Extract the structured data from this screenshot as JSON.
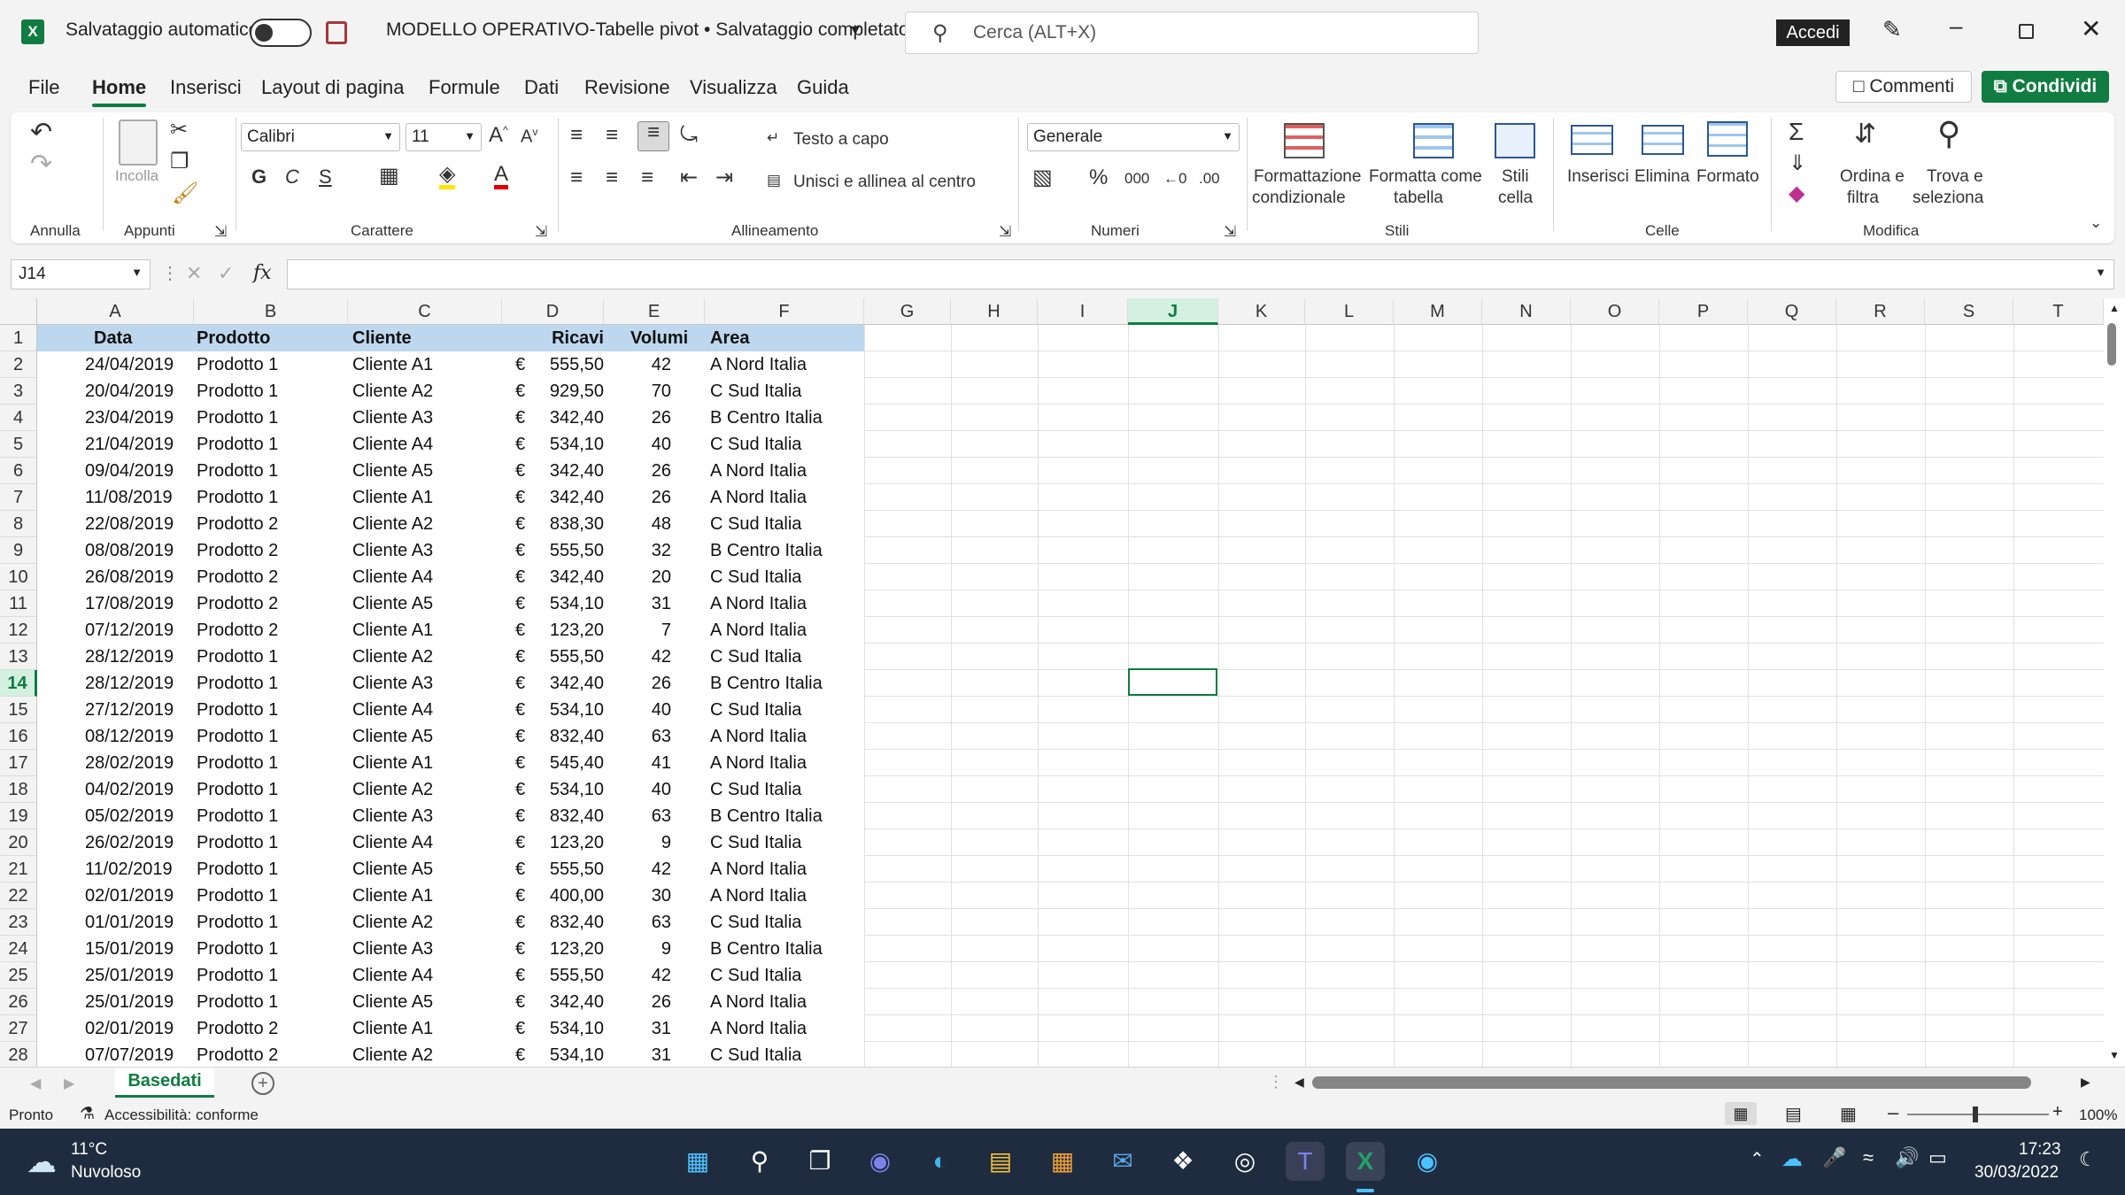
{
  "titlebar": {
    "autosave_label": "Salvataggio automatico",
    "autosave_state": "off",
    "doc_title": "MODELLO OPERATIVO-Tabelle pivot • Salvataggio completato",
    "search_placeholder": "Cerca (ALT+X)",
    "signin": "Accedi"
  },
  "menu": {
    "tabs": [
      "File",
      "Home",
      "Inserisci",
      "Layout di pagina",
      "Formule",
      "Dati",
      "Revisione",
      "Visualizza",
      "Guida"
    ],
    "active": "Home",
    "comments": "Commenti",
    "share": "Condividi"
  },
  "ribbon": {
    "groups": {
      "annulla": "Annulla",
      "appunti": "Appunti",
      "carattere": "Carattere",
      "allineamento": "Allineamento",
      "numeri": "Numeri",
      "stili": "Stili",
      "celle": "Celle",
      "modifica": "Modifica"
    },
    "paste": "Incolla",
    "font_name": "Calibri",
    "font_size": "11",
    "wrap_text": "Testo a capo",
    "merge_center": "Unisci e allinea al centro",
    "number_format": "Generale",
    "cond_format": [
      "Formattazione",
      "condizionale"
    ],
    "format_table": [
      "Formatta come",
      "tabella"
    ],
    "cell_styles": [
      "Stili",
      "cella"
    ],
    "insert": "Inserisci",
    "delete": "Elimina",
    "format": "Formato",
    "sort_filter": [
      "Ordina e",
      "filtra"
    ],
    "find_select": [
      "Trova e",
      "seleziona"
    ]
  },
  "formula_bar": {
    "name_box": "J14",
    "fx": "fx",
    "content": ""
  },
  "colors": {
    "accent": "#107c41",
    "header_fill": "#bdd7ee",
    "taskbar": "#1f2c3f"
  },
  "columns": [
    "A",
    "B",
    "C",
    "D",
    "E",
    "F",
    "G",
    "H",
    "I",
    "J",
    "K",
    "L",
    "M",
    "N",
    "O",
    "P",
    "Q",
    "R",
    "S",
    "T"
  ],
  "table": {
    "headers": [
      "Data",
      "Prodotto",
      "Cliente",
      "Ricavi",
      "Volumi",
      "Area"
    ],
    "currency": "€",
    "rows": [
      [
        "24/04/2019",
        "Prodotto 1",
        "Cliente A1",
        "555,50",
        "42",
        "A Nord Italia"
      ],
      [
        "20/04/2019",
        "Prodotto 1",
        "Cliente A2",
        "929,50",
        "70",
        "C Sud Italia"
      ],
      [
        "23/04/2019",
        "Prodotto 1",
        "Cliente A3",
        "342,40",
        "26",
        "B Centro Italia"
      ],
      [
        "21/04/2019",
        "Prodotto 1",
        "Cliente A4",
        "534,10",
        "40",
        "C Sud Italia"
      ],
      [
        "09/04/2019",
        "Prodotto 1",
        "Cliente A5",
        "342,40",
        "26",
        "A Nord Italia"
      ],
      [
        "11/08/2019",
        "Prodotto 1",
        "Cliente A1",
        "342,40",
        "26",
        "A Nord Italia"
      ],
      [
        "22/08/2019",
        "Prodotto 2",
        "Cliente A2",
        "838,30",
        "48",
        "C Sud Italia"
      ],
      [
        "08/08/2019",
        "Prodotto 2",
        "Cliente A3",
        "555,50",
        "32",
        "B Centro Italia"
      ],
      [
        "26/08/2019",
        "Prodotto 2",
        "Cliente A4",
        "342,40",
        "20",
        "C Sud Italia"
      ],
      [
        "17/08/2019",
        "Prodotto 2",
        "Cliente A5",
        "534,10",
        "31",
        "A Nord Italia"
      ],
      [
        "07/12/2019",
        "Prodotto 2",
        "Cliente A1",
        "123,20",
        "7",
        "A Nord Italia"
      ],
      [
        "28/12/2019",
        "Prodotto 1",
        "Cliente A2",
        "555,50",
        "42",
        "C Sud Italia"
      ],
      [
        "28/12/2019",
        "Prodotto 1",
        "Cliente A3",
        "342,40",
        "26",
        "B Centro Italia"
      ],
      [
        "27/12/2019",
        "Prodotto 1",
        "Cliente A4",
        "534,10",
        "40",
        "C Sud Italia"
      ],
      [
        "08/12/2019",
        "Prodotto 1",
        "Cliente A5",
        "832,40",
        "63",
        "A Nord Italia"
      ],
      [
        "28/02/2019",
        "Prodotto 1",
        "Cliente A1",
        "545,40",
        "41",
        "A Nord Italia"
      ],
      [
        "04/02/2019",
        "Prodotto 1",
        "Cliente A2",
        "534,10",
        "40",
        "C Sud Italia"
      ],
      [
        "05/02/2019",
        "Prodotto 1",
        "Cliente A3",
        "832,40",
        "63",
        "B Centro Italia"
      ],
      [
        "26/02/2019",
        "Prodotto 1",
        "Cliente A4",
        "123,20",
        "9",
        "C Sud Italia"
      ],
      [
        "11/02/2019",
        "Prodotto 1",
        "Cliente A5",
        "555,50",
        "42",
        "A Nord Italia"
      ],
      [
        "02/01/2019",
        "Prodotto 1",
        "Cliente A1",
        "400,00",
        "30",
        "A Nord Italia"
      ],
      [
        "01/01/2019",
        "Prodotto 1",
        "Cliente A2",
        "832,40",
        "63",
        "C Sud Italia"
      ],
      [
        "15/01/2019",
        "Prodotto 1",
        "Cliente A3",
        "123,20",
        "9",
        "B Centro Italia"
      ],
      [
        "25/01/2019",
        "Prodotto 1",
        "Cliente A4",
        "555,50",
        "42",
        "C Sud Italia"
      ],
      [
        "25/01/2019",
        "Prodotto 1",
        "Cliente A5",
        "342,40",
        "26",
        "A Nord Italia"
      ],
      [
        "02/01/2019",
        "Prodotto 2",
        "Cliente A1",
        "534,10",
        "31",
        "A Nord Italia"
      ],
      [
        "07/07/2019",
        "Prodotto 2",
        "Cliente A2",
        "534,10",
        "31",
        "C Sud Italia"
      ]
    ]
  },
  "sheet_tabs": [
    "Basedati"
  ],
  "status": {
    "ready": "Pronto",
    "accessibility": "Accessibilità: conforme",
    "zoom": "100%"
  },
  "taskbar": {
    "temperature": "11°C",
    "weather": "Nuvoloso",
    "time": "17:23",
    "date": "30/03/2022"
  }
}
